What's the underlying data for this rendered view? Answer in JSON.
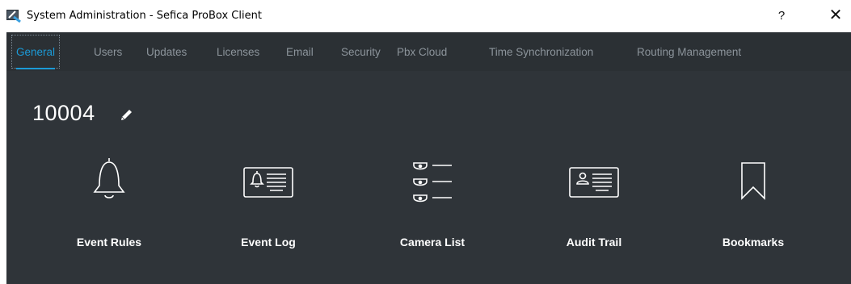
{
  "window": {
    "title": "System Administration - Sefica ProBox Client",
    "help_label": "?",
    "close_label": "✕"
  },
  "tabs": [
    {
      "label": "General",
      "active": true
    },
    {
      "label": "Users",
      "active": false
    },
    {
      "label": "Updates",
      "active": false
    },
    {
      "label": "Licenses",
      "active": false
    },
    {
      "label": "Email",
      "active": false
    },
    {
      "label": "Security",
      "active": false
    },
    {
      "label": "Pbx Cloud",
      "active": false
    },
    {
      "label": "Time Synchronization",
      "active": false
    },
    {
      "label": "Routing Management",
      "active": false
    }
  ],
  "device": {
    "title": "10004",
    "edit_icon": "pencil-icon"
  },
  "tiles": [
    {
      "label": "Event Rules",
      "icon": "bell-icon"
    },
    {
      "label": "Event Log",
      "icon": "event-log-card-icon"
    },
    {
      "label": "Camera List",
      "icon": "camera-list-icon"
    },
    {
      "label": "Audit Trail",
      "icon": "user-card-icon"
    },
    {
      "label": "Bookmarks",
      "icon": "bookmark-icon"
    }
  ],
  "colors": {
    "accent": "#1b9ad6",
    "background": "#2f3439",
    "tab_inactive": "#8c949b",
    "text": "#ffffff"
  }
}
